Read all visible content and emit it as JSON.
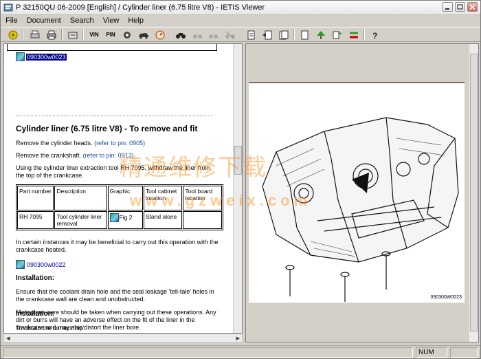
{
  "window": {
    "title": "P 32150QU 06-2009 [English] / Cylinder liner (6.75 litre V8) - IETIS Viewer"
  },
  "menu": [
    "File",
    "Document",
    "Search",
    "View",
    "Help"
  ],
  "toolbar": {
    "vin_label": "VIN",
    "pin_label": "PIN"
  },
  "document": {
    "ref1": "090300w0023",
    "heading": "Cylinder liner (6.75 litre V8) - To remove and fit",
    "step1": "Remove the cylinder heads.",
    "step1_link": "(refer to pin: 0905)",
    "step2": "Remove the crankshaft.",
    "step2_link": "(refer to pin: 0913)",
    "step3": "Using the cylinder liner extraction tool RH 7095, withdraw the liner from the top of the crankcase.",
    "table": {
      "headers": [
        "Part number",
        "Description",
        "Graphic",
        "Tool cabinet location",
        "Tool board location"
      ],
      "row": [
        "RH 7095",
        "Tool cylinder liner removal",
        "Fig 2",
        "Stand alone",
        ""
      ]
    },
    "step4": "In certain instances it may be beneficial to carry out this operation with the crankcase heated.",
    "ref2": "090300w0022",
    "install_heading": "Installation:",
    "install_p1": "Ensure that the coolant drain hole and the seal leakage 'tell-tale' holes in the crankcase wall are clean and unobstructed.",
    "install_p2": "Meticulous care should be taken when carrying out these operations. Any dirt or burrs will have an adverse effect on the fit of the liner in the crankcase and may also distort the liner bore.",
    "ref3": "090300w0023",
    "install_heading2": "Installation:",
    "install_p3": "To obtain the correct 'nip'."
  },
  "watermark": {
    "chinese": "精通维修下载",
    "url": "www.gzweix.com"
  },
  "drawing": {
    "figure_label": "090300W0023"
  },
  "status": {
    "num": "NUM"
  }
}
